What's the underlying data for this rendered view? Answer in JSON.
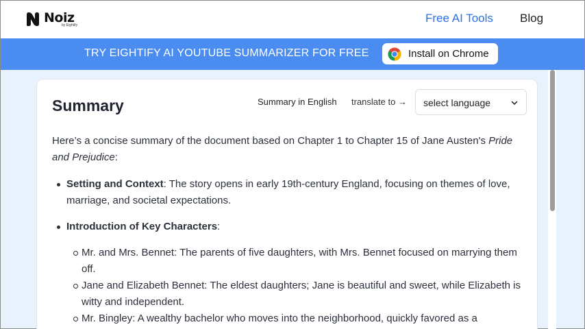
{
  "header": {
    "logo_text": "Noiz",
    "logo_sub": "by Eightify",
    "nav": [
      {
        "label": "Free AI Tools"
      },
      {
        "label": "Blog"
      }
    ]
  },
  "banner": {
    "text": "TRY EIGHTIFY AI YOUTUBE SUMMARIZER FOR FREE",
    "button_label": "Install on Chrome"
  },
  "summary": {
    "title": "Summary",
    "language_label": "Summary in English",
    "translate_label": "translate to →",
    "select_value": "select language",
    "intro_text": "Here’s a concise summary of the document based on Chapter 1 to Chapter 15 of Jane Austen's ",
    "intro_italic": "Pride and Prejudice",
    "intro_end": ":",
    "bullets": [
      {
        "title": "Setting and Context",
        "text": ": The story opens in early 19th-century England, focusing on themes of love, marriage, and societal expectations."
      },
      {
        "title": "Introduction of Key Characters",
        "text": ":"
      }
    ],
    "sub_items": [
      "Mr. and Mrs. Bennet: The parents of five daughters, with Mrs. Bennet focused on marrying them off.",
      "Jane and Elizabeth Bennet: The eldest daughters; Jane is beautiful and sweet, while Elizabeth is witty and independent.",
      "Mr. Bingley: A wealthy bachelor who moves into the neighborhood, quickly favored as a"
    ]
  },
  "colors": {
    "banner": "#4a8cf0",
    "nav_accent": "#2f6fe4",
    "page_bg": "#e8f2fd"
  }
}
